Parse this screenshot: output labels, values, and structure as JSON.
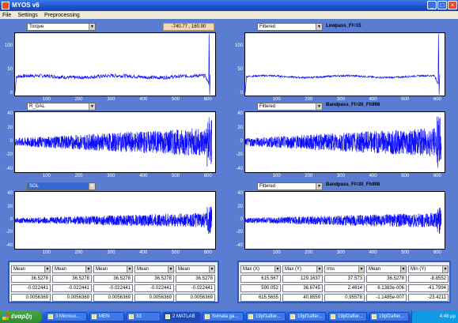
{
  "window": {
    "title": "MYOS v6",
    "controls": [
      "minimize",
      "maximize",
      "close"
    ]
  },
  "menu": [
    "File",
    "Settings",
    "Preprocessing"
  ],
  "left_panels": [
    {
      "dropdown": "Torque",
      "selected": false
    },
    {
      "dropdown": "R_GAL",
      "selected": false
    },
    {
      "dropdown": "SOL",
      "selected": true
    }
  ],
  "right_panels": [
    {
      "dropdown": "Filtered",
      "title": "Lowpass_Fl=15"
    },
    {
      "dropdown": "Filtered",
      "title": "Bandpass_Fl=20_Fh998"
    },
    {
      "dropdown": "Filtered",
      "title": "Bandpass_Fl=20_Fh998"
    }
  ],
  "coord_readout": "-740.77 , 160.90",
  "x_ticks": [
    "100",
    "200",
    "300",
    "400",
    "500",
    "600"
  ],
  "y_ticks_torque": [
    "100",
    "50",
    "0"
  ],
  "y_ticks_emg": [
    "40",
    "20",
    "0",
    "-20",
    "-40"
  ],
  "left_stats": {
    "headers": [
      "Mean",
      "Mean",
      "Mean",
      "Mean",
      "Mean"
    ],
    "rows": [
      [
        "36.5278",
        "36.5278",
        "36.5278",
        "36.5278",
        "36.5278"
      ],
      [
        "-0.022441",
        "-0.022441",
        "-0.022441",
        "-0.022441",
        "-0.022441"
      ],
      [
        "0.0056369",
        "0.0056369",
        "0.0056369",
        "0.0056369",
        "0.0056369"
      ]
    ]
  },
  "right_stats": {
    "headers": [
      "Max (X)",
      "Max (Y)",
      "rms",
      "Mean",
      "Min (Y)"
    ],
    "rows": [
      [
        "615.567",
        "129.1637",
        "37.573",
        "36.5278",
        "-8.8552"
      ],
      [
        "590.052",
        "36.6745",
        "2.4614",
        "6.1383e-006",
        "-41.7994"
      ],
      [
        "615.5655",
        "40.8559",
        "0.95578",
        "-1.1485e-007",
        "-23.4211"
      ]
    ]
  },
  "taskbar": {
    "start": "έναρξη",
    "tasks": [
      "3 Microso...",
      "MEN",
      "33",
      "2 MATLAB",
      "Svinata ga...",
      "19pf1after...",
      "19pf1after...",
      "19pf2after...",
      "19pf2after..."
    ],
    "active_task_index": 3,
    "clock": "4:48 μμ"
  },
  "colors": {
    "panel_bg": "#5a7cd1",
    "signal": "#0000ff",
    "highlight": "#3168d5"
  }
}
